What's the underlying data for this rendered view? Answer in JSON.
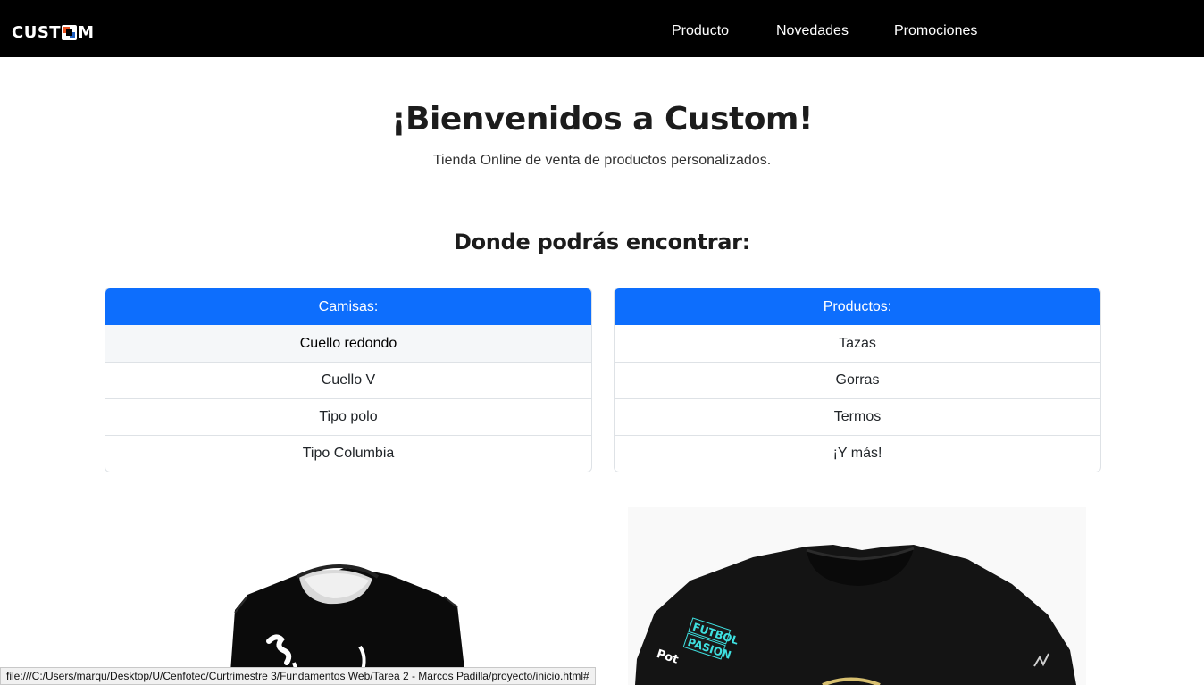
{
  "brand": {
    "logo_prefix": "CUST",
    "logo_suffix": "M",
    "logo_colors": [
      "#e8501e",
      "#1f5fbf"
    ]
  },
  "nav": {
    "items": [
      "Producto",
      "Novedades",
      "Promociones"
    ]
  },
  "hero": {
    "title": "¡Bienvenidos a Custom!",
    "subtitle": "Tienda Online de venta de productos personalizados."
  },
  "section": {
    "title": "Donde podrás encontrar:"
  },
  "lists": [
    {
      "header": "Camisas:",
      "items": [
        "Cuello redondo",
        "Cuello V",
        "Tipo polo",
        "Tipo Columbia"
      ]
    },
    {
      "header": "Productos:",
      "items": [
        "Tazas",
        "Gorras",
        "Termos",
        "¡Y más!"
      ]
    }
  ],
  "images": [
    {
      "name": "shirt-image-left",
      "shirt_color": "#0b0b0b"
    },
    {
      "name": "shirt-image-right",
      "shirt_color": "#141414",
      "print_text": [
        "FUTBOL",
        "PASION",
        "Pot"
      ]
    }
  ],
  "status": {
    "url": "file:///C:/Users/marqu/Desktop/U/Cenfotec/Curtrimestre 3/Fundamentos Web/Tarea 2 - Marcos Padilla/proyecto/inicio.html#"
  },
  "colors": {
    "navbar": "#000000",
    "primary": "#0d6efd",
    "list_hover": "#f5f7f9"
  }
}
